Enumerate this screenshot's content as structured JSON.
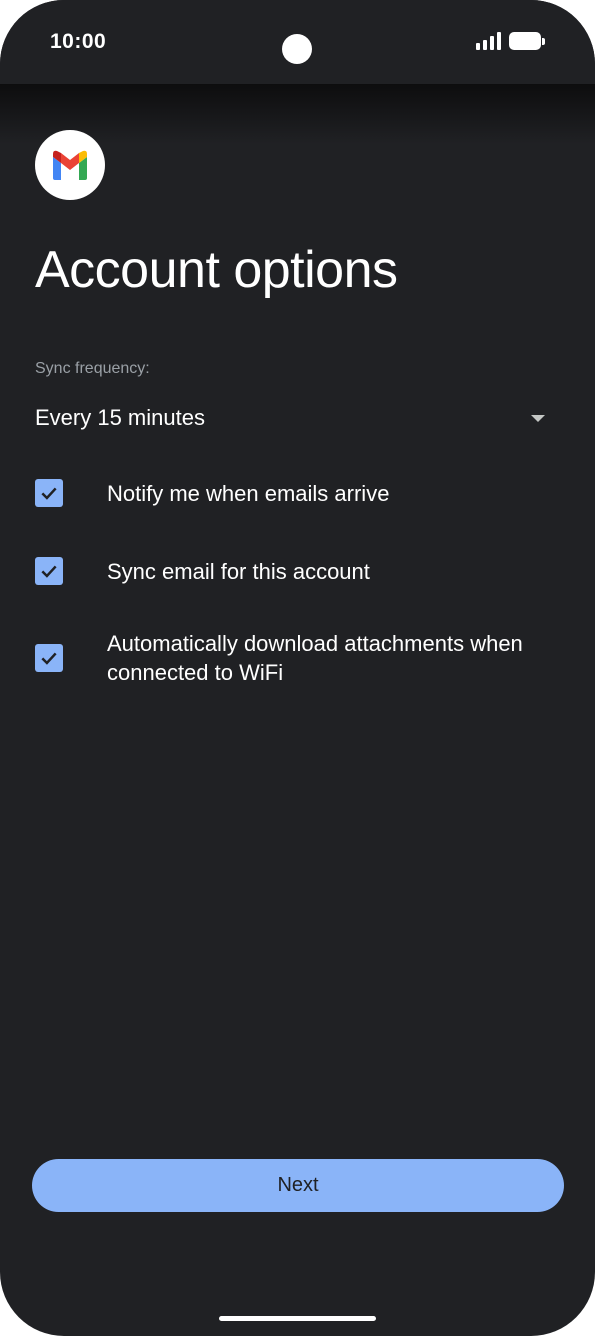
{
  "status_bar": {
    "time": "10:00"
  },
  "app": {
    "logo_icon": "gmail-logo-icon"
  },
  "page": {
    "title": "Account options"
  },
  "sync": {
    "label": "Sync frequency:",
    "selected": "Every 15 minutes"
  },
  "options": [
    {
      "label": "Notify me when emails arrive",
      "checked": true
    },
    {
      "label": "Sync email for this account",
      "checked": true
    },
    {
      "label": "Automatically download attachments when connected to WiFi",
      "checked": true
    }
  ],
  "actions": {
    "next_label": "Next"
  },
  "colors": {
    "background": "#202124",
    "accent": "#8ab4f8",
    "text": "#ffffff",
    "muted": "#9aa0a6"
  }
}
